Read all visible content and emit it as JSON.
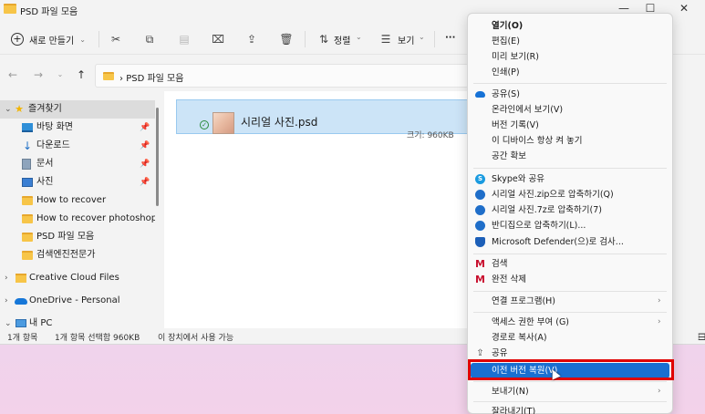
{
  "window": {
    "title": "PSD 파일 모음"
  },
  "window_controls": {
    "minimize": "—",
    "maximize": "☐",
    "close": "✕"
  },
  "toolbar": {
    "new_label": "새로 만들기",
    "sort_label": "정렬",
    "view_label": "보기",
    "more_label": "···",
    "icons": [
      "cut-icon",
      "copy-icon",
      "paste-icon",
      "rename-icon",
      "share-icon",
      "delete-icon"
    ]
  },
  "address": {
    "breadcrumb": "PSD 파일 모음",
    "separator": "›"
  },
  "nav": {
    "items": [
      {
        "label": "즐겨찾기",
        "icon": "star-icon"
      },
      {
        "label": "바탕 화면",
        "icon": "desktop-icon"
      },
      {
        "label": "다운로드",
        "icon": "download-icon"
      },
      {
        "label": "문서",
        "icon": "document-icon"
      },
      {
        "label": "사진",
        "icon": "pictures-icon"
      },
      {
        "label": "How to recover",
        "icon": "folder-icon"
      },
      {
        "label": "How to recover photoshop_AI",
        "icon": "folder-icon"
      },
      {
        "label": "PSD 파일 모음",
        "icon": "folder-icon"
      },
      {
        "label": "검색엔진전문가",
        "icon": "folder-icon"
      },
      {
        "label": "Creative Cloud Files",
        "icon": "creative-cloud-icon"
      },
      {
        "label": "OneDrive - Personal",
        "icon": "onedrive-icon"
      },
      {
        "label": "내 PC",
        "icon": "pc-icon"
      }
    ]
  },
  "file": {
    "name": "시리얼 사진.psd",
    "size": "크기: 960KB"
  },
  "status": {
    "count": "1개 항목",
    "selected": "1개 항목 선택함 960KB",
    "availability": "이 장치에서 사용 가능"
  },
  "context_menu": {
    "items": [
      {
        "label": "열기(O)",
        "bold": true
      },
      {
        "label": "편집(E)"
      },
      {
        "label": "미리 보기(R)"
      },
      {
        "label": "인쇄(P)"
      },
      {
        "label": "공유(S)",
        "icon": "onedrive-icon"
      },
      {
        "label": "온라인에서 보기(V)"
      },
      {
        "label": "버전 기록(V)"
      },
      {
        "label": "이 디바이스 항상 켜 놓기"
      },
      {
        "label": "공간 확보"
      },
      {
        "label": "Skype와 공유",
        "icon": "skype-icon"
      },
      {
        "label": "시리얼 사진.zip으로 압축하기(Q)",
        "icon": "bandizip-icon"
      },
      {
        "label": "시리얼 사진.7z로 압축하기(7)",
        "icon": "bandizip-icon"
      },
      {
        "label": "반디집으로 압축하기(L)...",
        "icon": "bandizip-icon"
      },
      {
        "label": "Microsoft Defender(으)로 검사...",
        "icon": "defender-icon"
      },
      {
        "label": "검색",
        "icon": "mcafee-icon"
      },
      {
        "label": "완전 삭제",
        "icon": "mcafee-icon"
      },
      {
        "label": "연결 프로그램(H)",
        "submenu": true
      },
      {
        "label": "액세스 권한 부여 (G)",
        "submenu": true
      },
      {
        "label": "경로로 복사(A)"
      },
      {
        "label": "공유",
        "icon": "share-icon"
      },
      {
        "label": "이전 버전 복원(V)",
        "highlighted": true
      },
      {
        "label": "보내기(N)",
        "submenu": true
      },
      {
        "label": "잘라내기(T)"
      }
    ]
  },
  "colors": {
    "highlight": "#1a6fd1",
    "annotation_box": "#e00000",
    "selection": "#cce4f7"
  }
}
